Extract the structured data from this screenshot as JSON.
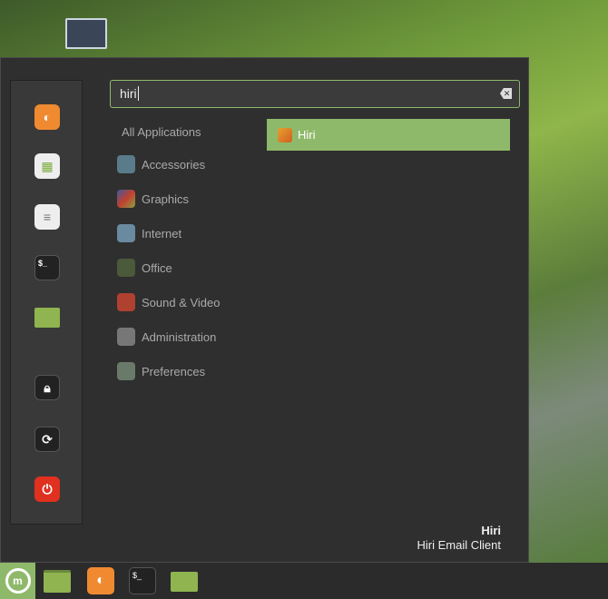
{
  "search": {
    "value": "hiri"
  },
  "categories": {
    "all": "All Applications",
    "items": [
      {
        "label": "Accessories",
        "color": "#5a7c8a"
      },
      {
        "label": "Graphics",
        "color": "#7a6a3a"
      },
      {
        "label": "Internet",
        "color": "#6a8aa0"
      },
      {
        "label": "Office",
        "color": "#4a5a3a"
      },
      {
        "label": "Sound & Video",
        "color": "#b04030"
      },
      {
        "label": "Administration",
        "color": "#777777"
      },
      {
        "label": "Preferences",
        "color": "#6a7a6a"
      }
    ]
  },
  "results": [
    {
      "label": "Hiri"
    }
  ],
  "info": {
    "name": "Hiri",
    "description": "Hiri Email Client"
  },
  "colors": {
    "accent": "#8fb96a",
    "menu_bg": "#2f2f2f"
  }
}
